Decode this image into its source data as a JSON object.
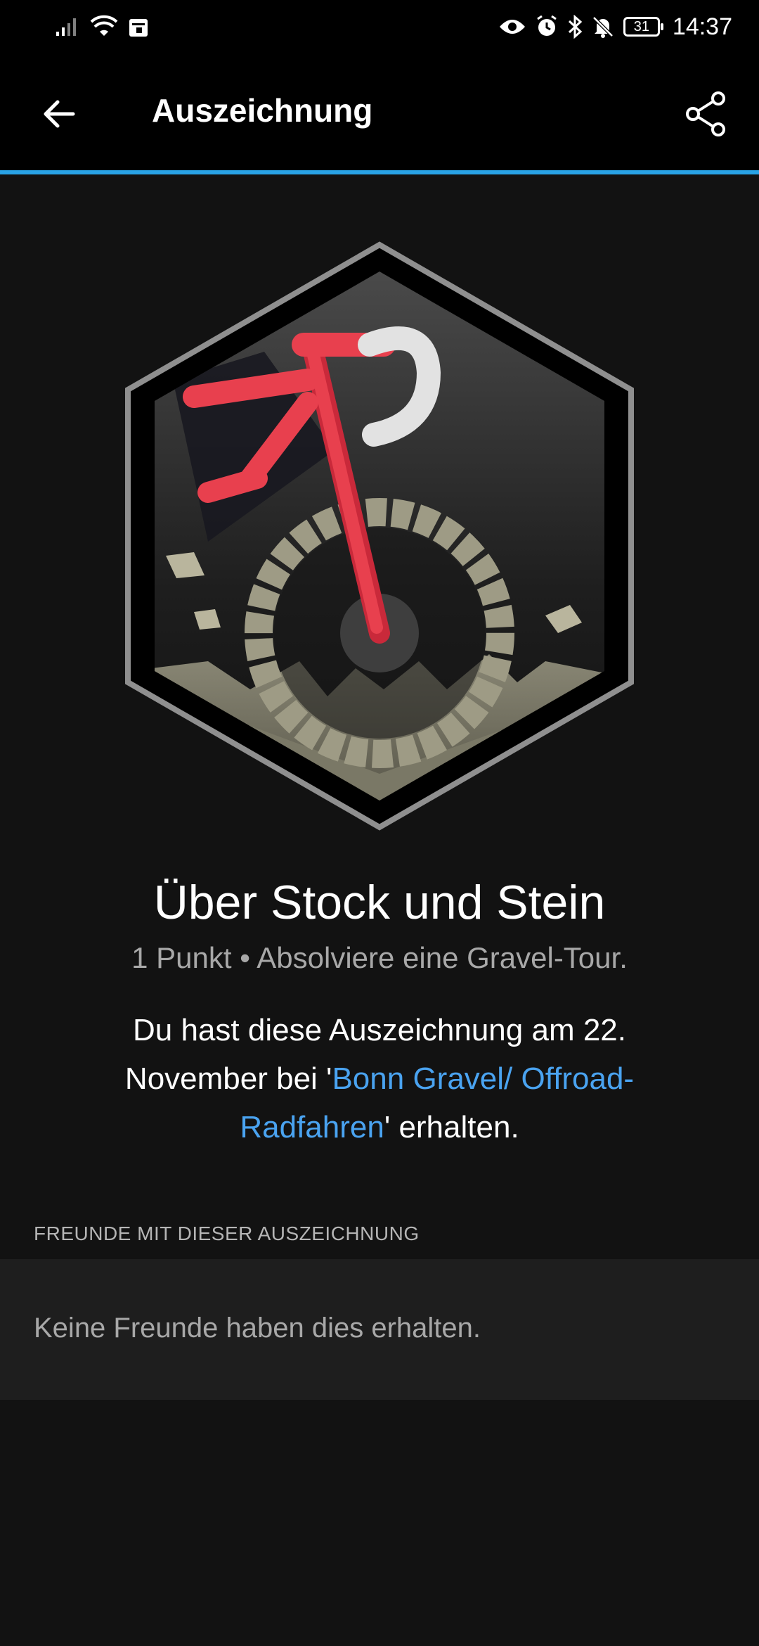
{
  "status_bar": {
    "time": "14:37",
    "battery": "31",
    "icons": [
      "signal-icon",
      "wifi-icon",
      "calendar-icon",
      "eye-icon",
      "alarm-icon",
      "bluetooth-icon",
      "bell-off-icon",
      "battery-icon"
    ]
  },
  "app_bar": {
    "title": "Auszeichnung",
    "back_icon": "arrow-left-icon",
    "share_icon": "share-icon"
  },
  "colors": {
    "accent": "#29a3e6",
    "link": "#4aa3f0",
    "badge_red": "#e8404e",
    "badge_tire": "#9e9b85"
  },
  "badge": {
    "icon": "gravel-bike-badge-icon",
    "title": "Über Stock und Stein",
    "subtitle": "1 Punkt • Absolviere eine Gravel-Tour.",
    "earned_prefix": "Du hast diese Auszeichnung am 22. November bei '",
    "earned_link": "Bonn Gravel/ Offroad-Radfahren",
    "earned_suffix": "' erhalten."
  },
  "friends": {
    "header": "FREUNDE MIT DIESER AUSZEICHNUNG",
    "empty_text": "Keine Freunde haben dies erhalten."
  }
}
